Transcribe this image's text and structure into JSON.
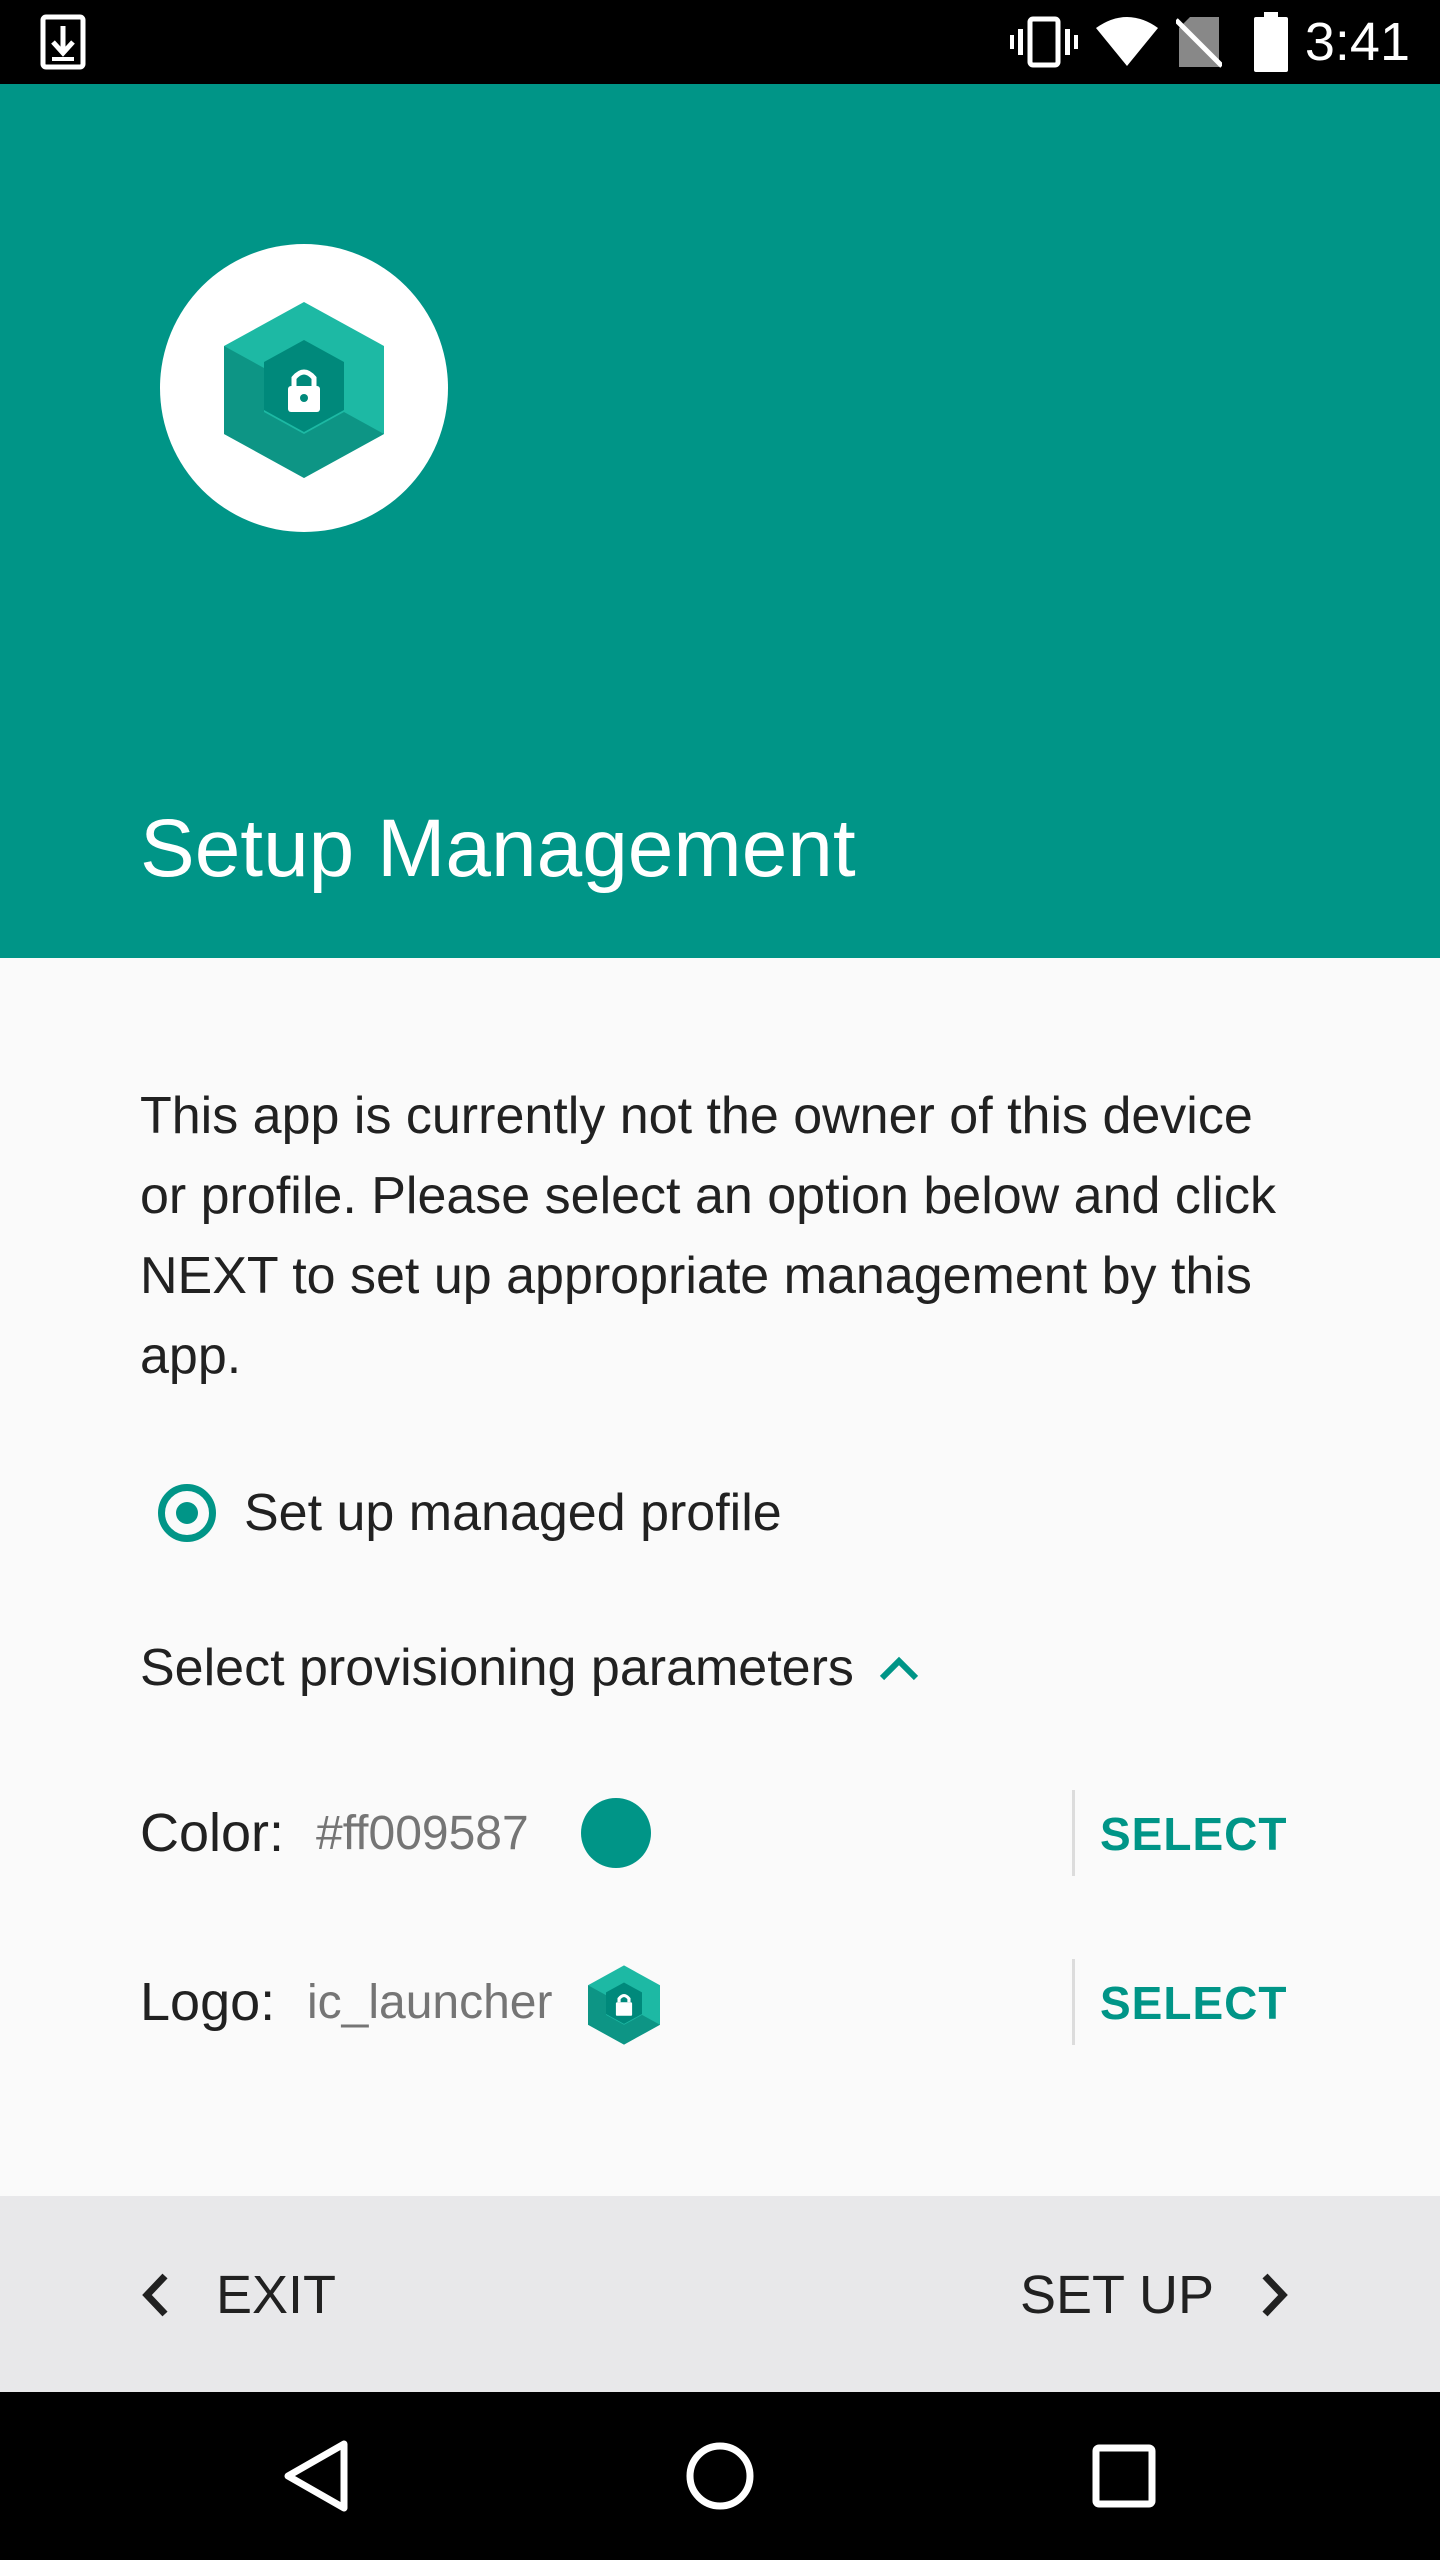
{
  "status_bar": {
    "time": "3:41",
    "icons": [
      "download-icon",
      "vibrate-icon",
      "wifi-icon",
      "no-sim-icon",
      "battery-icon"
    ]
  },
  "header": {
    "title": "Setup Management",
    "logo_icon": "app-logo-icon",
    "background_color": "#009587"
  },
  "content": {
    "description": "This app is currently not the owner of this device or profile. Please select an option below and click NEXT to set up appropriate management by this app.",
    "option": {
      "label": "Set up managed profile",
      "selected": true
    },
    "params_header": "Select provisioning parameters",
    "params": [
      {
        "name": "Color:",
        "value": "#ff009587",
        "action": "SELECT",
        "swatch_color": "#009587"
      },
      {
        "name": "Logo:",
        "value": "ic_launcher",
        "action": "SELECT"
      }
    ]
  },
  "actions": {
    "exit_label": "EXIT",
    "setup_label": "SET UP"
  },
  "nav": {
    "buttons": [
      "back-icon",
      "home-icon",
      "recents-icon"
    ]
  },
  "colors": {
    "accent": "#009587",
    "text_primary": "#212121",
    "text_secondary": "#757575"
  }
}
